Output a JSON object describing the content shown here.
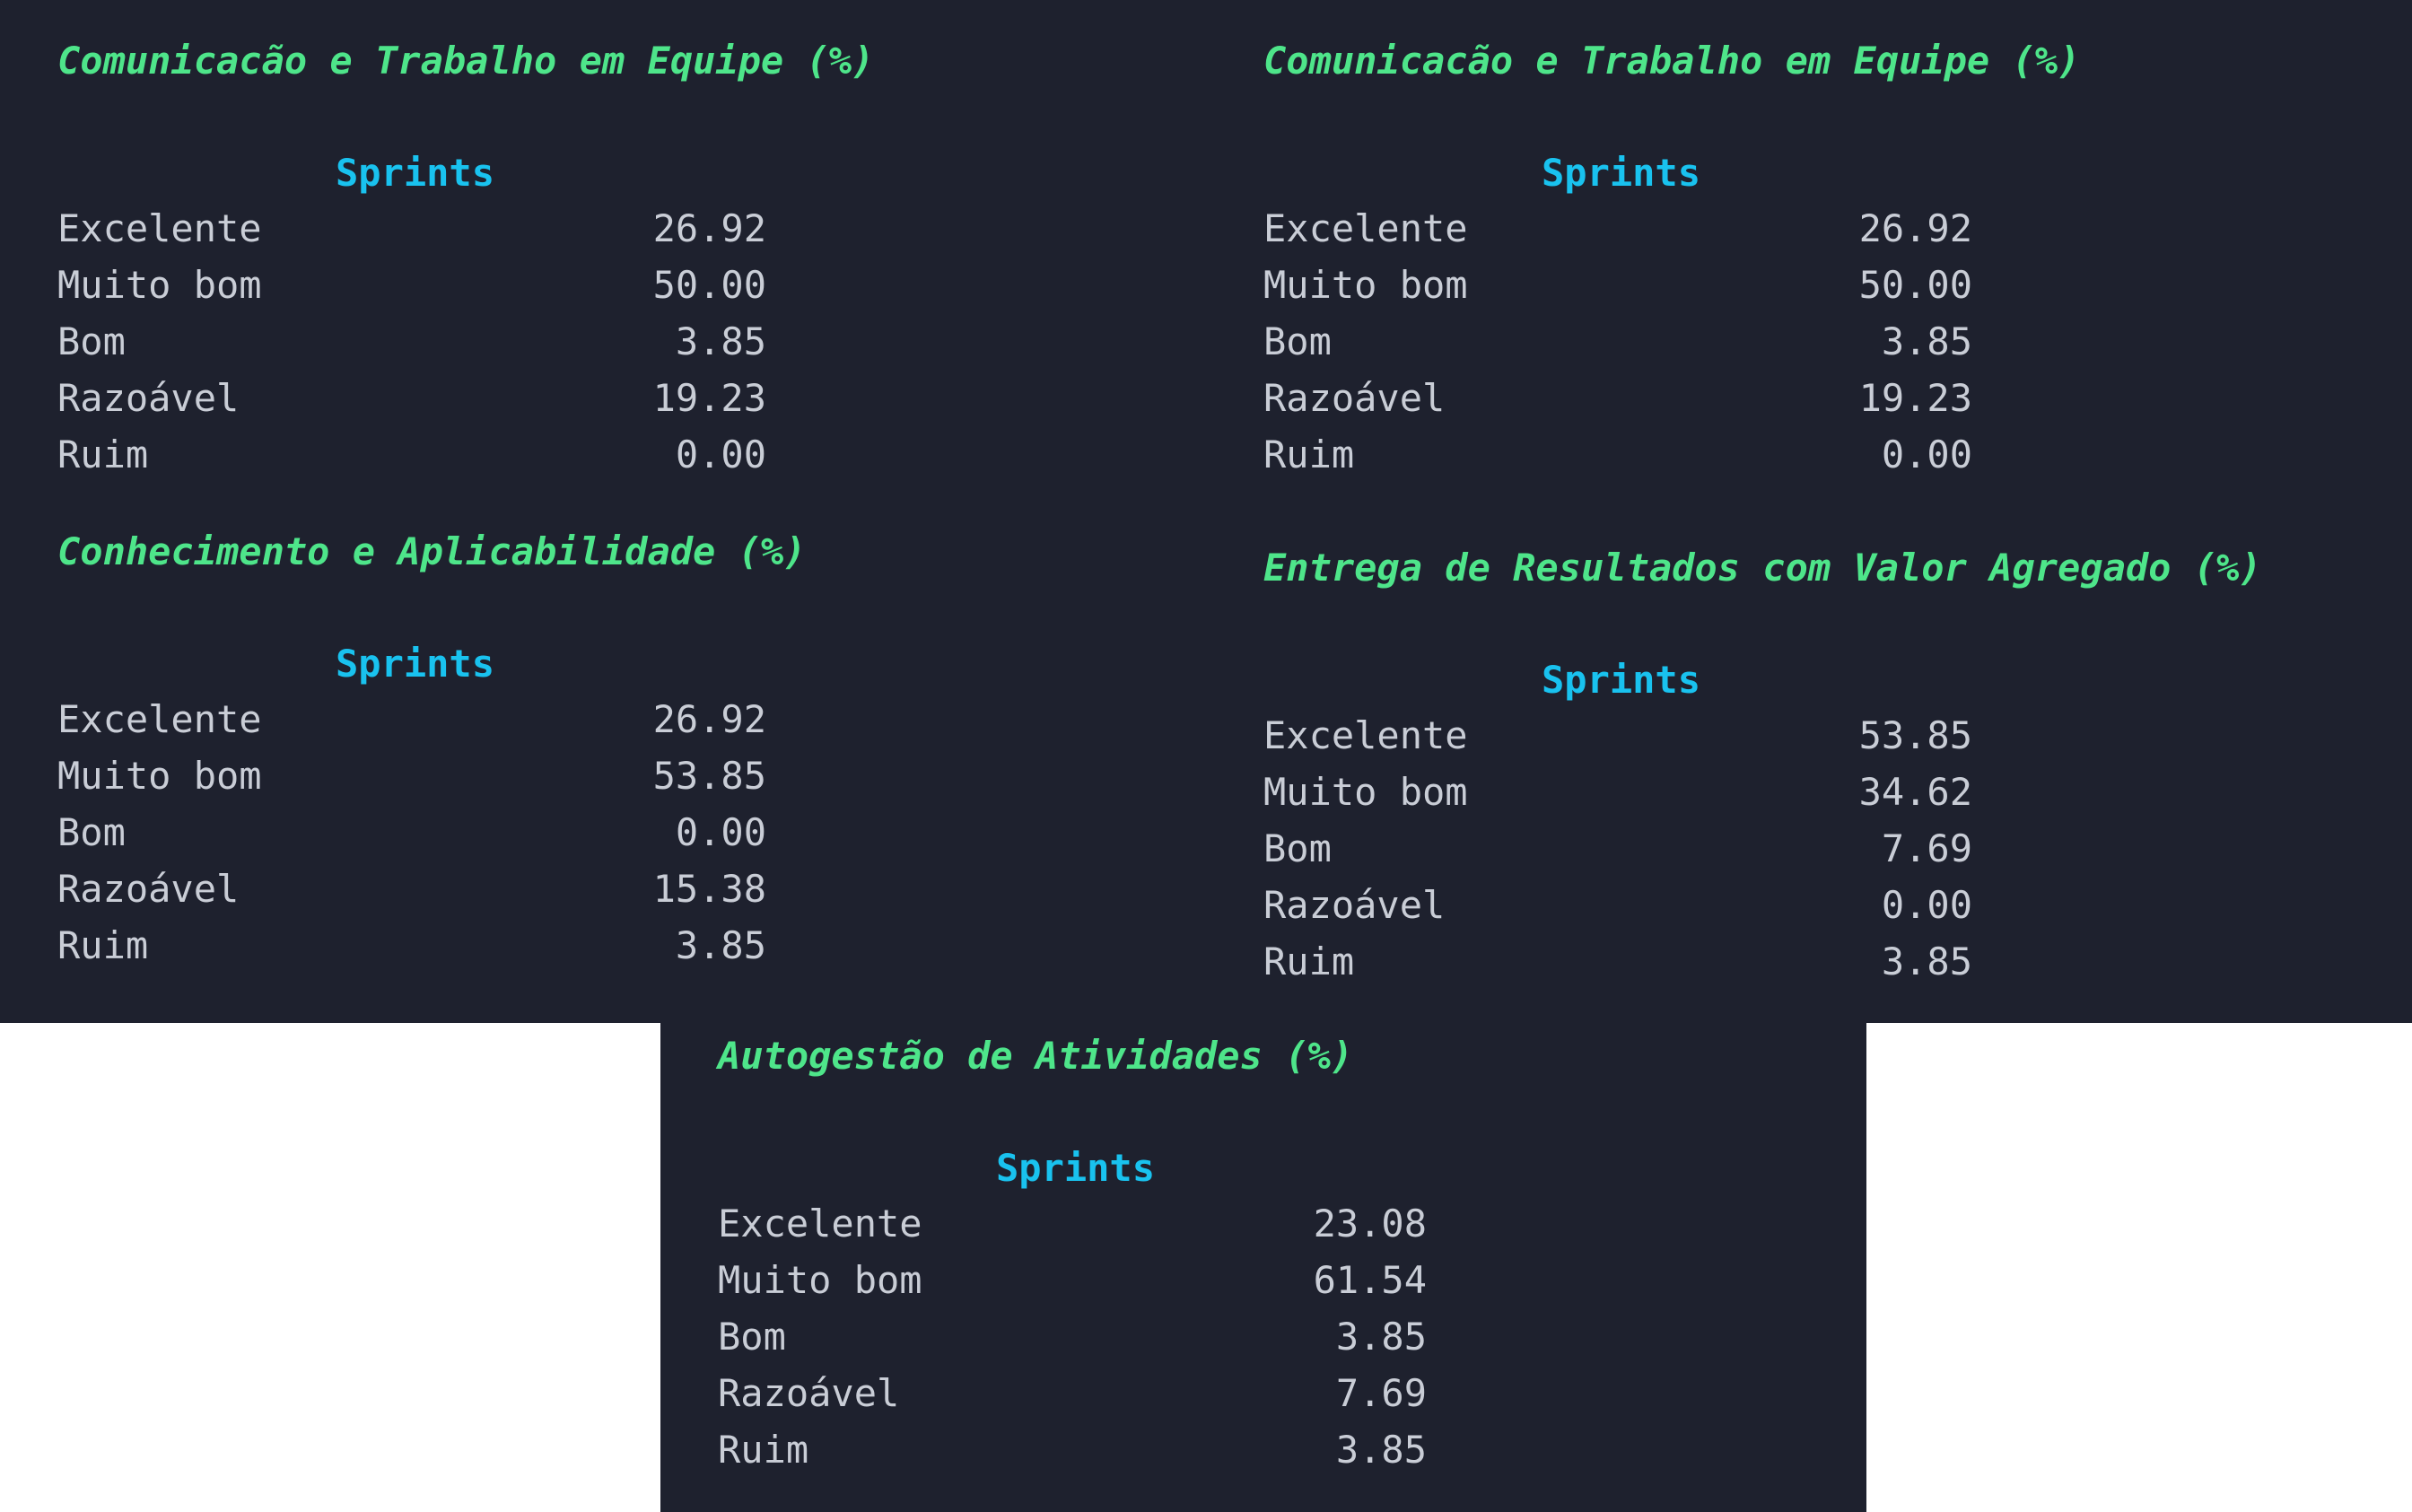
{
  "header_label": "Sprints",
  "blocks": [
    {
      "title": "Comunicacão e Trabalho em Equipe (%)",
      "rows": [
        {
          "label": "Excelente",
          "value": "26.92"
        },
        {
          "label": "Muito bom",
          "value": "50.00"
        },
        {
          "label": "Bom",
          "value": "3.85"
        },
        {
          "label": "Razoável",
          "value": "19.23"
        },
        {
          "label": "Ruim",
          "value": "0.00"
        }
      ]
    },
    {
      "title": "Comunicacão e Trabalho em Equipe (%)",
      "rows": [
        {
          "label": "Excelente",
          "value": "26.92"
        },
        {
          "label": "Muito bom",
          "value": "50.00"
        },
        {
          "label": "Bom",
          "value": "3.85"
        },
        {
          "label": "Razoável",
          "value": "19.23"
        },
        {
          "label": "Ruim",
          "value": "0.00"
        }
      ]
    },
    {
      "title": "Conhecimento e Aplicabilidade (%)",
      "rows": [
        {
          "label": "Excelente",
          "value": "26.92"
        },
        {
          "label": "Muito bom",
          "value": "53.85"
        },
        {
          "label": "Bom",
          "value": "0.00"
        },
        {
          "label": "Razoável",
          "value": "15.38"
        },
        {
          "label": "Ruim",
          "value": "3.85"
        }
      ]
    },
    {
      "title": "Entrega de Resultados com Valor Agregado (%)",
      "rows": [
        {
          "label": "Excelente",
          "value": "53.85"
        },
        {
          "label": "Muito bom",
          "value": "34.62"
        },
        {
          "label": "Bom",
          "value": "7.69"
        },
        {
          "label": "Razoável",
          "value": "0.00"
        },
        {
          "label": "Ruim",
          "value": "3.85"
        }
      ]
    },
    {
      "title": "Autogestão de Atividades (%)",
      "rows": [
        {
          "label": "Excelente",
          "value": "23.08"
        },
        {
          "label": "Muito bom",
          "value": "61.54"
        },
        {
          "label": "Bom",
          "value": "3.85"
        },
        {
          "label": "Razoável",
          "value": "7.69"
        },
        {
          "label": "Ruim",
          "value": "3.85"
        }
      ]
    }
  ],
  "colors": {
    "panel_background": "#1e212e",
    "title": "#4ee58a",
    "header": "#19c2ef",
    "text": "#c9cdd6",
    "page_background": "#ffffff"
  }
}
